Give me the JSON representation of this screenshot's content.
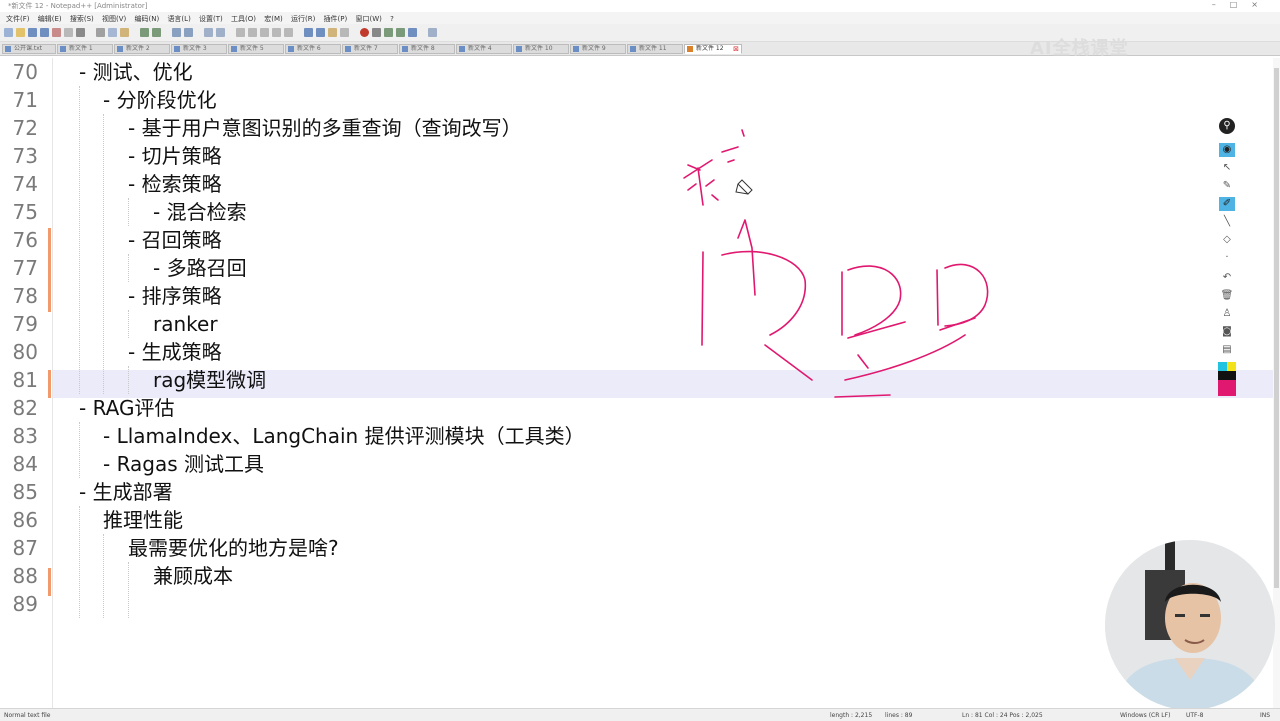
{
  "window": {
    "title": "*新文件 12 - Notepad++ [Administrator]",
    "controls": [
      "–",
      "□",
      "×"
    ]
  },
  "menu": [
    "文件(F)",
    "编辑(E)",
    "搜索(S)",
    "视图(V)",
    "编码(N)",
    "语言(L)",
    "设置(T)",
    "工具(O)",
    "宏(M)",
    "运行(R)",
    "插件(P)",
    "窗口(W)",
    "?"
  ],
  "tabs": [
    "公开课.txt",
    "新文件 1",
    "新文件 2",
    "新文件 3",
    "新文件 5",
    "新文件 6",
    "新文件 7",
    "新文件 8",
    "新文件 4",
    "新文件 10",
    "新文件 9",
    "新文件 11",
    "新文件 12"
  ],
  "watermark": "AI全栈课堂",
  "editor": {
    "lines": [
      {
        "num": "70",
        "text": "- 测试、优化"
      },
      {
        "num": "71",
        "text": "- 分阶段优化"
      },
      {
        "num": "72",
        "text": "- 基于用户意图识别的多重查询（查询改写）"
      },
      {
        "num": "73",
        "text": "- 切片策略"
      },
      {
        "num": "74",
        "text": "- 检索策略"
      },
      {
        "num": "75",
        "text": "- 混合检索"
      },
      {
        "num": "76",
        "text": "- 召回策略"
      },
      {
        "num": "77",
        "text": "- 多路召回"
      },
      {
        "num": "78",
        "text": "- 排序策略"
      },
      {
        "num": "79",
        "text": "ranker"
      },
      {
        "num": "80",
        "text": "- 生成策略"
      },
      {
        "num": "81",
        "text": "rag模型微调"
      },
      {
        "num": "82",
        "text": "- RAG评估"
      },
      {
        "num": "83",
        "text": "- LlamaIndex、LangChain 提供评测模块（工具类）"
      },
      {
        "num": "84",
        "text": "- Ragas 测试工具"
      },
      {
        "num": "85",
        "text": "- 生成部署"
      },
      {
        "num": "86",
        "text": "推理性能"
      },
      {
        "num": "87",
        "text": "最需要优化的地方是啥?"
      },
      {
        "num": "88",
        "text": "兼顾成本"
      },
      {
        "num": "89",
        "text": ""
      }
    ]
  },
  "status": {
    "file_type": "Normal text file",
    "length": "length : 2,215",
    "lines": "lines : 89",
    "position": "Ln : 81    Col : 24    Pos : 2,025",
    "eol": "Windows (CR LF)",
    "encoding": "UTF-8",
    "mode": "INS"
  },
  "colors": {
    "ink": "#e0186f",
    "current_line": "#ebebfa",
    "change_marker": "#f29a6b"
  },
  "draw_tools": [
    "pin-icon",
    "eye-icon",
    "pointer-icon",
    "pen-icon",
    "highlighter-icon",
    "line-icon",
    "eraser-icon",
    "dot-icon",
    "undo-icon",
    "trash-icon",
    "stamp-icon",
    "camera-icon",
    "clipboard-icon"
  ],
  "palette": [
    "#22c3e0",
    "#f2e21a",
    "#111111",
    "#e0186f"
  ]
}
